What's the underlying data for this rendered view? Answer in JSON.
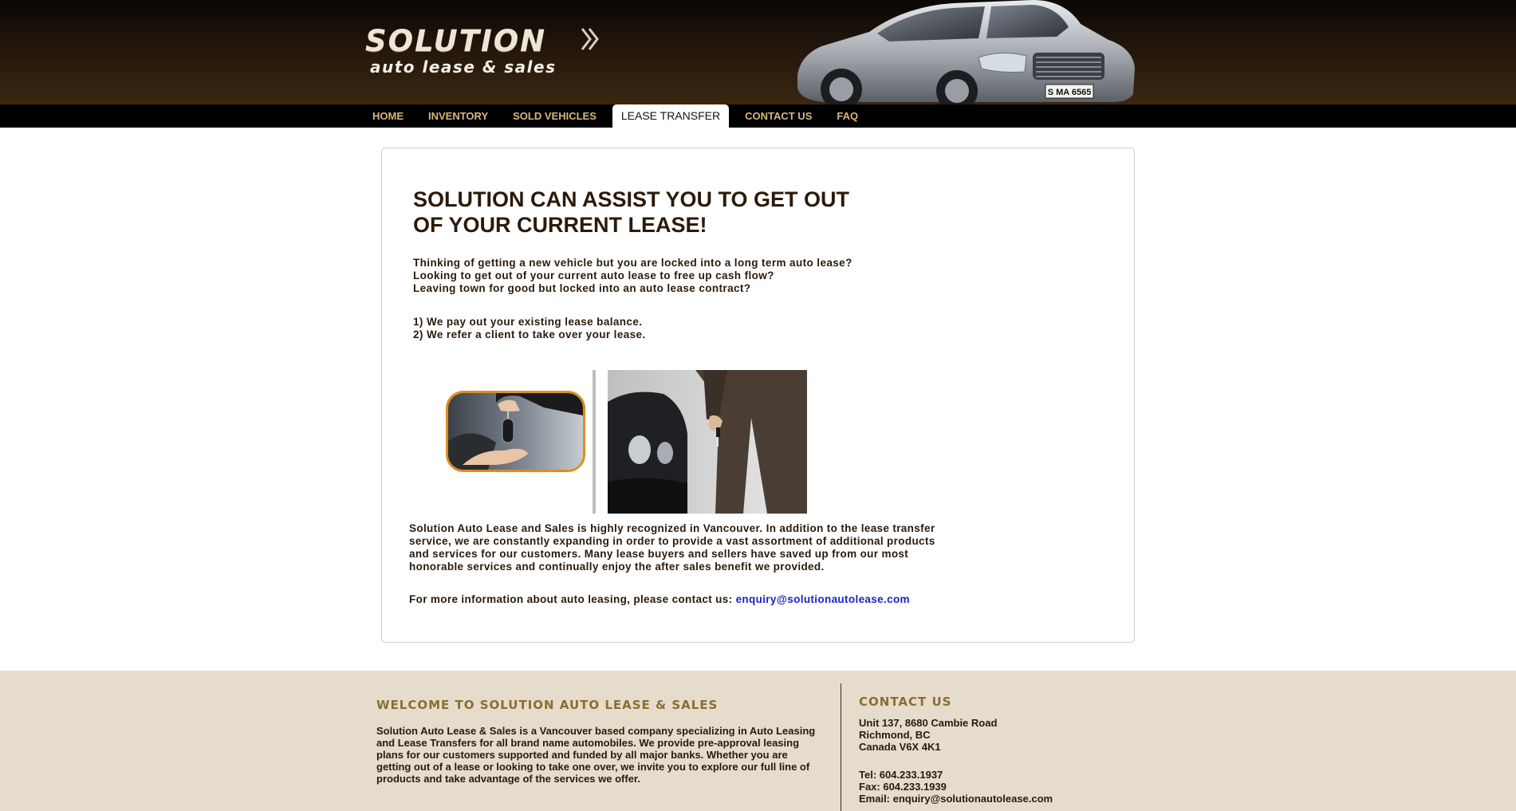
{
  "header": {
    "logo_main": "SOLUTION",
    "logo_sub": "auto lease & sales",
    "plate": "S MA 6565"
  },
  "nav": {
    "items": [
      {
        "label": "HOME"
      },
      {
        "label": "INVENTORY"
      },
      {
        "label": "SOLD VEHICLES"
      },
      {
        "label": "LEASE TRANSFER",
        "active": true
      },
      {
        "label": "CONTACT US"
      },
      {
        "label": "FAQ"
      }
    ]
  },
  "main": {
    "headline_line1": "SOLUTION CAN ASSIST YOU TO GET OUT",
    "headline_line2": "OF YOUR CURRENT LEASE!",
    "intro": [
      "Thinking of getting a new vehicle but you are locked into a long term auto lease?",
      "Looking to get out of your current auto lease to free up cash flow?",
      "Leaving town for good but locked into an auto lease contract?"
    ],
    "options": [
      "1) We pay out your existing lease balance.",
      "2) We refer a client to take over your lease."
    ],
    "about": "Solution Auto Lease and Sales is highly recognized in Vancouver. In addition to the lease transfer service, we are constantly expanding in order to provide a vast assortment of additional products and services for our customers. Many lease buyers and sellers have saved up from our most honorable services and continually enjoy the after sales benefit we provided.",
    "more_info_text": "For more information about auto leasing, please contact us: ",
    "more_info_email": "enquiry@solutionautolease.com"
  },
  "footer": {
    "welcome_heading": "WELCOME TO SOLUTION AUTO LEASE & SALES",
    "welcome_text": "Solution Auto Lease & Sales is a Vancouver based company specializing in Auto Leasing and Lease Transfers for all brand name automobiles. We provide pre-approval leasing plans for our customers supported and funded by all major banks. Whether you are getting out of a lease or looking to take one over, we invite you to explore our full line of products and take advantage of the services we offer.",
    "contact_heading": "CONTACT US",
    "address": [
      "Unit 137, 8680 Cambie Road",
      "Richmond, BC",
      "Canada V6X 4K1"
    ],
    "tel": "Tel: 604.233.1937",
    "fax": "Fax: 604.233.1939",
    "email_label": "Email: ",
    "email": "enquiry@solutionautolease.com"
  },
  "colors": {
    "nav_text": "#d9b777",
    "headline": "#2b1a0a",
    "link": "#1a24c9",
    "footer_bg": "#e6dccb",
    "footer_heading": "#8a6d33",
    "photo_border": "#e08c1d"
  }
}
